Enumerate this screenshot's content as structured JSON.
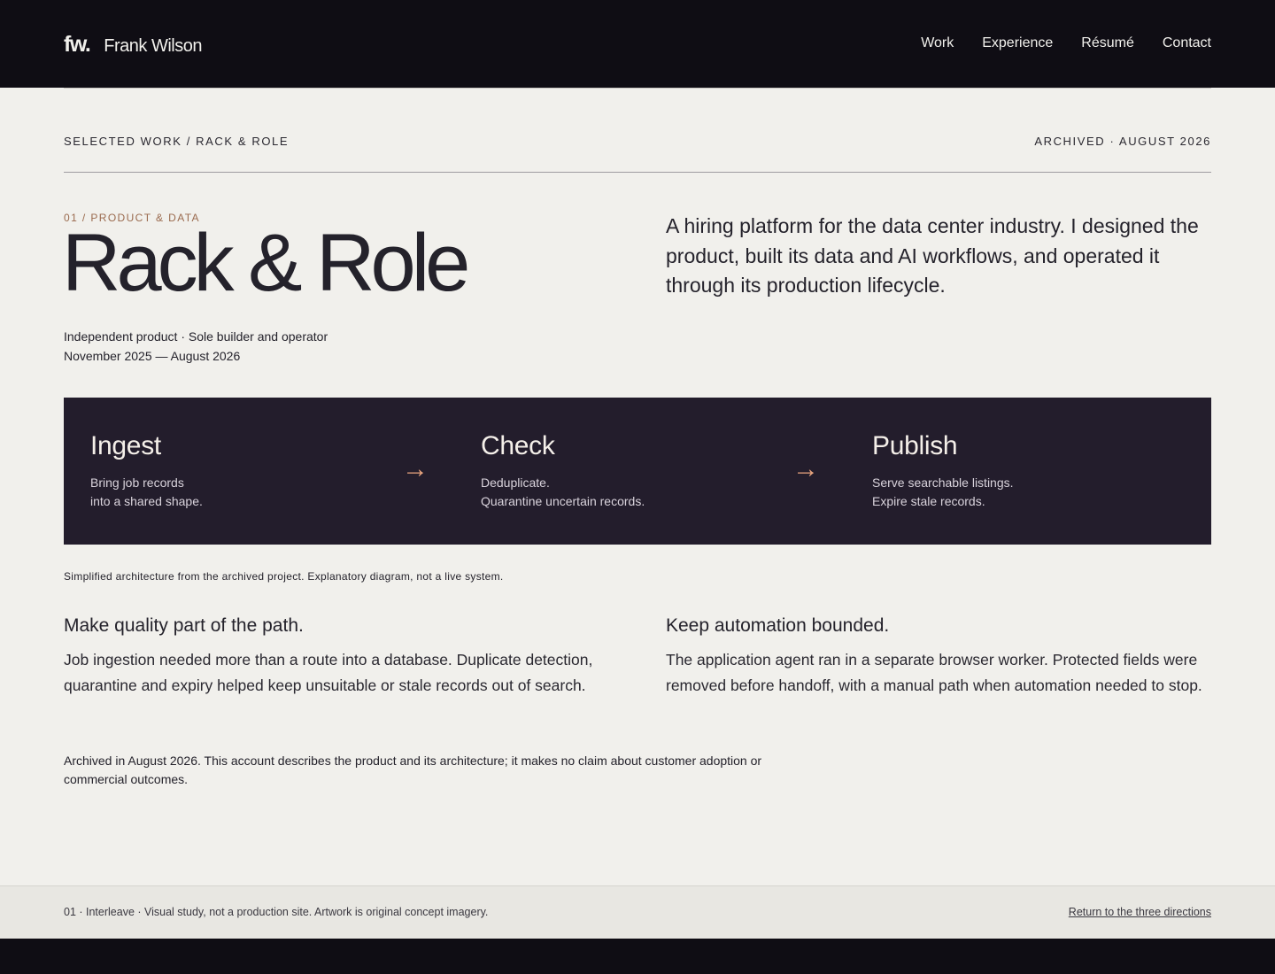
{
  "header": {
    "logo": "fw.",
    "name": "Frank Wilson",
    "nav": [
      "Work",
      "Experience",
      "Résumé",
      "Contact"
    ]
  },
  "crumbs": {
    "path": "SELECTED WORK / RACK & ROLE",
    "status": "ARCHIVED · AUGUST 2026"
  },
  "project": {
    "kicker": "01 / PRODUCT & DATA",
    "title": "Rack & Role",
    "meta_line1": "Independent product · Sole builder and operator",
    "meta_line2": "November 2025 — August 2026",
    "lede": "A hiring platform for the data center industry. I designed the product, built its data and AI workflows, and operated it through its production lifecycle."
  },
  "diagram": {
    "arrow": "→",
    "steps": [
      {
        "title": "Ingest",
        "line1": "Bring job records",
        "line2": "into a shared shape."
      },
      {
        "title": "Check",
        "line1": "Deduplicate.",
        "line2": "Quarantine uncertain records."
      },
      {
        "title": "Publish",
        "line1": "Serve searchable listings.",
        "line2": "Expire stale records."
      }
    ],
    "caption": "Simplified architecture from the archived project. Explanatory diagram, not a live system.",
    "accent_color": "#e8a47e",
    "background_color": "#231d2c"
  },
  "sections": [
    {
      "heading": "Make quality part of the path.",
      "body": "Job ingestion needed more than a route into a database. Duplicate detection, quarantine and expiry helped keep unsuitable or stale records out of search."
    },
    {
      "heading": "Keep automation bounded.",
      "body": "The application agent ran in a separate browser worker. Protected fields were removed before handoff, with a manual path when automation needed to stop."
    }
  ],
  "note": "Archived in August 2026. This account describes the product and its architecture; it makes no claim about customer adoption or commercial outcomes.",
  "footer": {
    "left": "01 · Interleave · Visual study, not a production site. Artwork is original concept imagery.",
    "link": "Return to the three directions"
  }
}
